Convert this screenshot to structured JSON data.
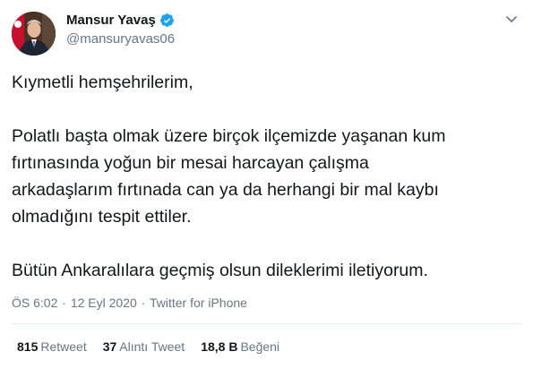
{
  "author": {
    "display_name": "Mansur Yavaş",
    "handle": "@mansuryavas06"
  },
  "icons": {
    "verified": "verified-badge-icon",
    "menu": "chevron-down-icon"
  },
  "colors": {
    "verified_blue": "#1da1f2",
    "secondary_text": "#657786",
    "primary_text": "#14171a",
    "divider": "#e6ecf0"
  },
  "tweet": {
    "lines": [
      "Kıymetli hemşehrilerim,",
      "",
      "Polatlı başta olmak üzere birçok ilçemizde yaşanan kum",
      "fırtınasında yoğun bir mesai harcayan çalışma",
      "arkadaşlarım fırtınada can ya da herhangi bir mal kaybı",
      "olmadığını tespit ettiler.",
      "",
      "Bütün Ankaralılara geçmiş olsun dileklerimi iletiyorum."
    ]
  },
  "meta": {
    "time": "ÖS 6:02",
    "separator": "·",
    "date": "12 Eyl 2020",
    "source": "Twitter for iPhone"
  },
  "stats": {
    "retweets_count": "815",
    "retweets_label": "Retweet",
    "quotes_count": "37",
    "quotes_label": "Alıntı Tweet",
    "likes_count": "18,8 B",
    "likes_label": "Beğeni"
  }
}
